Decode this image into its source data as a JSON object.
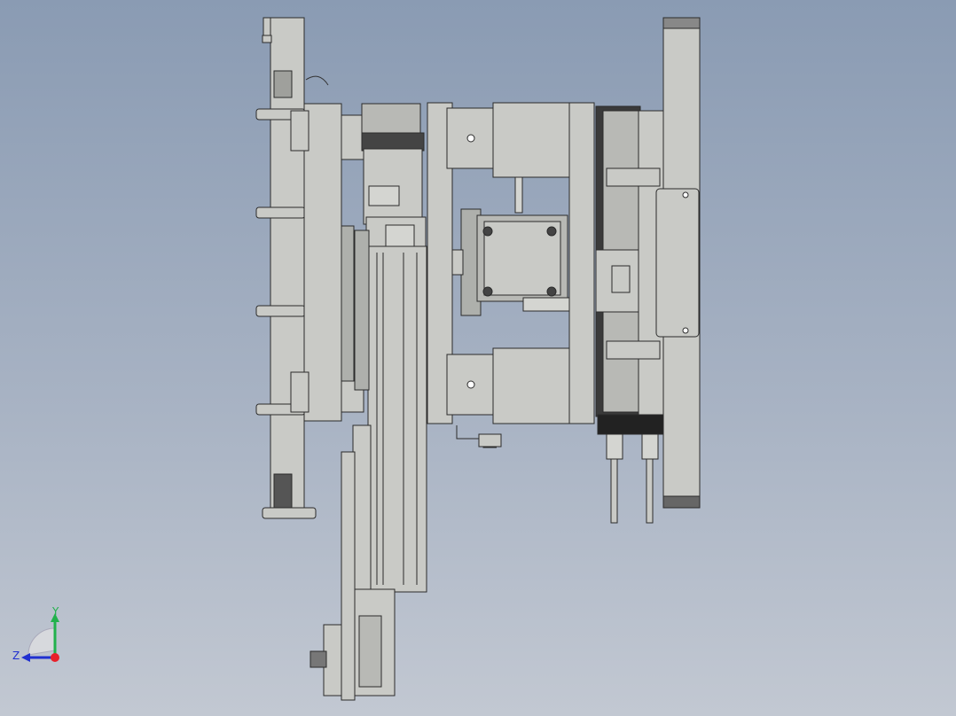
{
  "viewport": {
    "background_top": "#8a9bb3",
    "background_bottom": "#c2c8d2"
  },
  "model": {
    "part_fill": "#c9cac6",
    "part_stroke": "#2b2b2b",
    "dark_part_fill": "#3a3a3a",
    "mid_part_fill": "#9fa09c"
  },
  "triad": {
    "x_color": "#e8202a",
    "y_color": "#22b14c",
    "z_color": "#2030d0",
    "labels": {
      "y": "Y",
      "z": "Z"
    }
  }
}
